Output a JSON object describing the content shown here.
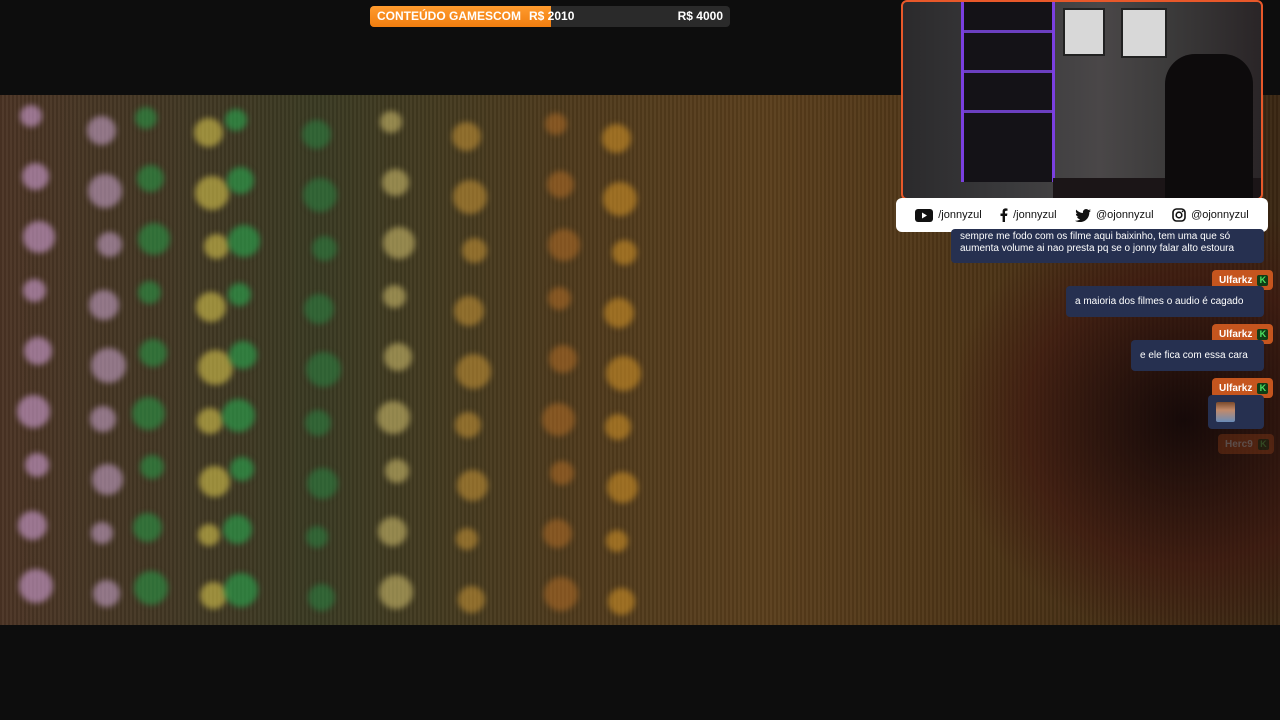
{
  "goal": {
    "title": "CONTEÚDO GAMESCOM",
    "current": "R$ 2010",
    "target": "R$ 4000",
    "progress": 0.5025
  },
  "social": {
    "youtube": "/jonnyzul",
    "facebook": "/jonnyzul",
    "twitter": "@ojonnyzul",
    "instagram": "@ojonnyzul"
  },
  "chat": {
    "messages": [
      {
        "text_line1": "sempre me fodo com os filme aqui baixinho, tem uma que só",
        "text_line2": "aumenta volume ai nao presta pq se o jonny falar alto estoura"
      },
      {
        "user": "Ulfarkz",
        "text": "a maioria dos filmes o audio é cagado"
      },
      {
        "user": "Ulfarkz",
        "text": "e ele fica com essa cara"
      },
      {
        "user": "Ulfarkz",
        "emote": "face-emote"
      }
    ],
    "pending_user": "Herc9"
  },
  "colors": {
    "accent": "#f07d0f",
    "chat_bubble": "#263050",
    "name_tag": "#c5551e",
    "webcam_border": "#e8582a"
  }
}
